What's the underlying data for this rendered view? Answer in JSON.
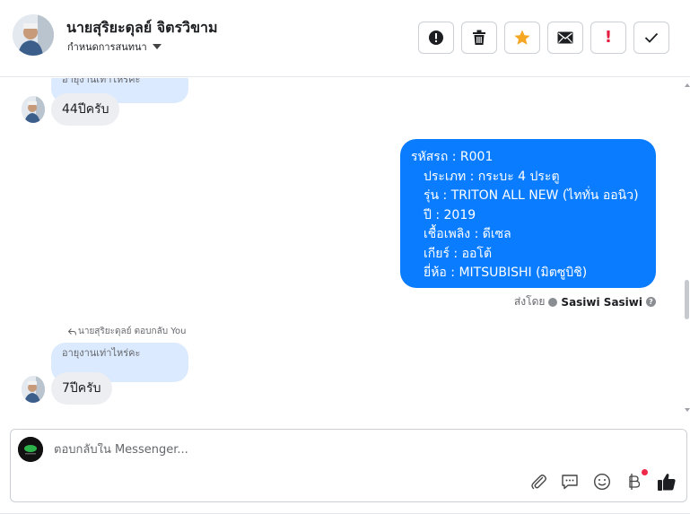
{
  "header": {
    "contact_name": "นายสุริยะดุลย์ จิตรวิขาม",
    "assign_label": "กำหนดการสนทนา",
    "actions": [
      {
        "name": "report-button",
        "icon": "alert-circle-icon"
      },
      {
        "name": "delete-button",
        "icon": "trash-icon"
      },
      {
        "name": "star-button",
        "icon": "star-icon"
      },
      {
        "name": "mark-unread-button",
        "icon": "envelope-icon"
      },
      {
        "name": "follow-up-button",
        "icon": "exclamation-icon"
      },
      {
        "name": "done-button",
        "icon": "check-icon"
      }
    ],
    "colors": {
      "star": "#f5a623",
      "follow_up": "#e41e3f"
    }
  },
  "messages": {
    "top_quote": "อายุงานเท่าไหร่คะ",
    "reply1": "44ปีครับ",
    "outgoing_lines": [
      "รหัสรถ : R001",
      "ประเภท : กระบะ 4 ประตู",
      "รุ่น : TRITON ALL NEW (ไททั่น ออนิว)",
      "ปี : 2019",
      "เชื้อเพลิง : ดีเซล",
      "เกียร์ : ออโต้",
      "ยี่ห้อ : MITSUBISHI (มิตซูบิชิ)"
    ],
    "sent_by_label": "ส่งโดย",
    "sent_by_name": "Sasiwi Sasiwi",
    "reply_note": "นายสุริยะดุลย์ ตอบกลับ You",
    "quote2": "อายุงานเท่าไหร่คะ",
    "reply2": "7ปีครับ",
    "outgoing_color": "#0a7cff"
  },
  "composer": {
    "placeholder": "ตอบกลับใน Messenger...",
    "tools": [
      "paperclip-icon",
      "saved-replies-icon",
      "emoji-icon",
      "baht-payment-icon",
      "thumbs-up-icon"
    ]
  }
}
